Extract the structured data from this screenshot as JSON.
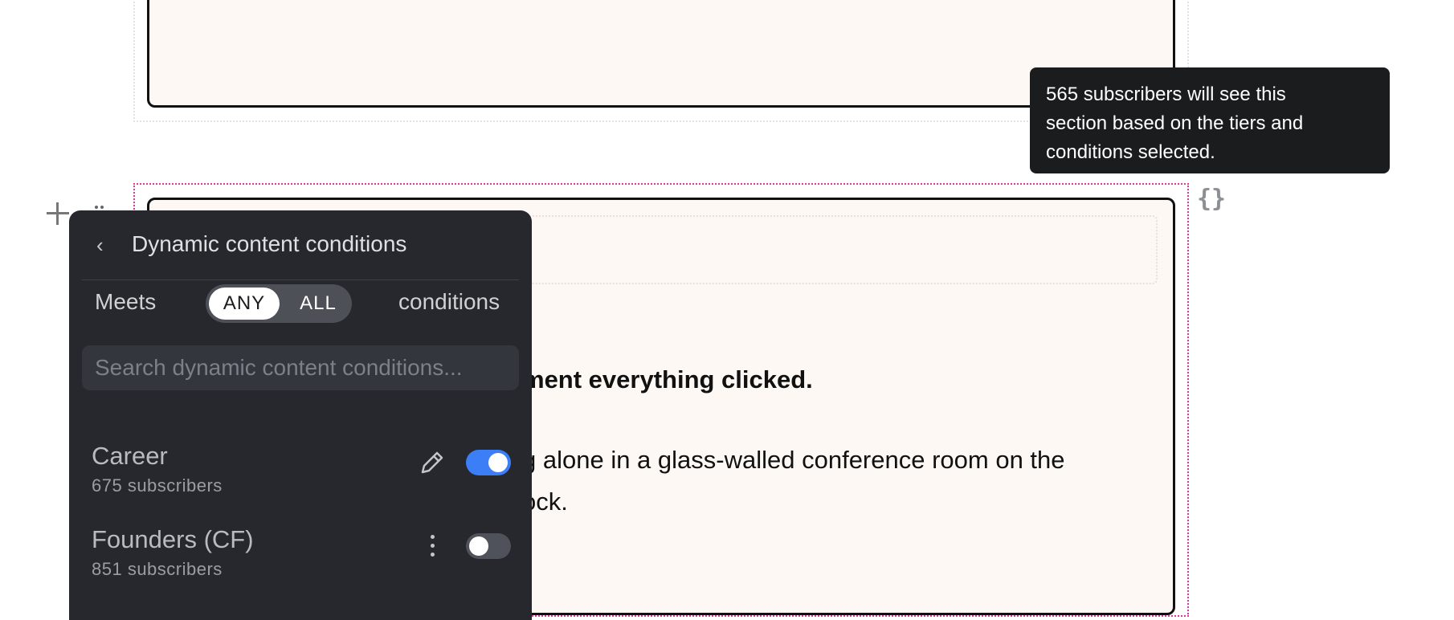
{
  "tooltip": {
    "line1": "565 subscribers will see this",
    "line2": "section based on the tiers and",
    "line3": "conditions selected."
  },
  "content": {
    "heading_fragment": "ment everything clicked.",
    "para_line1": "g alone in a glass-walled conference room on the",
    "para_line2": "ock."
  },
  "icons": {
    "braces": "{}",
    "back": "‹"
  },
  "panel": {
    "title": "Dynamic content conditions",
    "meets_label": "Meets",
    "any_label": "ANY",
    "all_label": "ALL",
    "conditions_label": "conditions",
    "search_placeholder": "Search dynamic content conditions...",
    "selected_mode": "ANY",
    "items": [
      {
        "name": "Career",
        "subscribers": "675 subscribers",
        "enabled": true,
        "action_icon": "pencil-icon"
      },
      {
        "name": "Founders (CF)",
        "subscribers": "851 subscribers",
        "enabled": false,
        "action_icon": "more-vertical-icon"
      }
    ]
  },
  "colors": {
    "toggle_on": "#3b7ef5",
    "selected_outline": "#e0379a",
    "panel_bg": "#26282d",
    "card_bg": "#fdf8f3"
  }
}
